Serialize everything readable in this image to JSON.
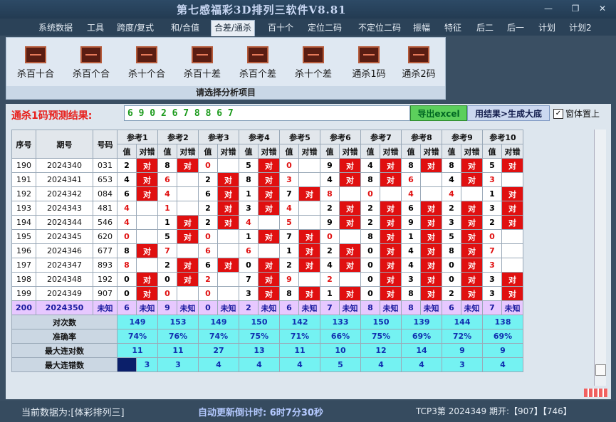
{
  "title": "第七感福彩3D排列三软件V8.81",
  "menu": [
    "系统数据",
    "工具",
    "跨度/复式",
    "和/合值",
    "合差/通杀",
    "百十个",
    "定位二码",
    "不定位二码",
    "振幅",
    "特征",
    "后二",
    "后一",
    "计划",
    "计划2"
  ],
  "active_menu": "合差/通杀",
  "ribbon": {
    "items": [
      "杀百十合",
      "杀百个合",
      "杀十个合",
      "杀百十差",
      "杀百个差",
      "杀十个差",
      "通杀1码",
      "通杀2码"
    ],
    "caption": "请选择分析项目"
  },
  "prediction": {
    "label": "通杀1码预测结果:",
    "value": "6 9 0 2 6 7 8 8 6 7",
    "excel_button": "导出excel",
    "generate_button": "用结果>生成大底",
    "topmost_label": "窗体置上",
    "topmost_checked": true
  },
  "table": {
    "headers": [
      "序号",
      "期号",
      "号码"
    ],
    "ref_headers": [
      "参考1",
      "参考2",
      "参考3",
      "参考4",
      "参考5",
      "参考6",
      "参考7",
      "参考8",
      "参考9",
      "参考10"
    ],
    "sub_headers": [
      "值",
      "对错"
    ],
    "rows": [
      {
        "seq": "190",
        "issue": "2024340",
        "num": "031",
        "vals": [
          "2",
          "8",
          "0",
          "5",
          "0",
          "9",
          "4",
          "8",
          "8",
          "5"
        ],
        "marks": [
          1,
          1,
          0,
          1,
          0,
          1,
          1,
          1,
          1,
          1
        ]
      },
      {
        "seq": "191",
        "issue": "2024341",
        "num": "653",
        "vals": [
          "4",
          "6",
          "2",
          "8",
          "3",
          "4",
          "8",
          "6",
          "4",
          "3"
        ],
        "marks": [
          1,
          0,
          1,
          1,
          0,
          1,
          1,
          0,
          1,
          0
        ]
      },
      {
        "seq": "192",
        "issue": "2024342",
        "num": "084",
        "vals": [
          "6",
          "4",
          "6",
          "1",
          "7",
          "8",
          "0",
          "4",
          "4",
          "1"
        ],
        "marks": [
          1,
          0,
          1,
          1,
          1,
          0,
          0,
          0,
          0,
          1
        ]
      },
      {
        "seq": "193",
        "issue": "2024343",
        "num": "481",
        "vals": [
          "4",
          "1",
          "2",
          "3",
          "4",
          "2",
          "2",
          "6",
          "2",
          "3"
        ],
        "marks": [
          0,
          0,
          1,
          1,
          0,
          1,
          1,
          1,
          1,
          1
        ]
      },
      {
        "seq": "194",
        "issue": "2024344",
        "num": "546",
        "vals": [
          "4",
          "1",
          "2",
          "4",
          "5",
          "9",
          "2",
          "9",
          "3",
          "2"
        ],
        "marks": [
          0,
          1,
          1,
          0,
          0,
          1,
          1,
          1,
          1,
          1
        ]
      },
      {
        "seq": "195",
        "issue": "2024345",
        "num": "620",
        "vals": [
          "0",
          "5",
          "0",
          "1",
          "7",
          "0",
          "8",
          "1",
          "5",
          "0"
        ],
        "marks": [
          0,
          1,
          0,
          1,
          1,
          0,
          1,
          1,
          1,
          0
        ]
      },
      {
        "seq": "196",
        "issue": "2024346",
        "num": "677",
        "vals": [
          "8",
          "7",
          "6",
          "6",
          "1",
          "2",
          "0",
          "4",
          "8",
          "7"
        ],
        "marks": [
          1,
          0,
          0,
          0,
          1,
          1,
          1,
          1,
          1,
          0
        ]
      },
      {
        "seq": "197",
        "issue": "2024347",
        "num": "893",
        "vals": [
          "8",
          "2",
          "6",
          "0",
          "2",
          "4",
          "0",
          "4",
          "0",
          "3"
        ],
        "marks": [
          0,
          1,
          1,
          1,
          1,
          1,
          1,
          1,
          1,
          0
        ]
      },
      {
        "seq": "198",
        "issue": "2024348",
        "num": "192",
        "vals": [
          "0",
          "0",
          "2",
          "7",
          "9",
          "2",
          "0",
          "3",
          "0",
          "3"
        ],
        "marks": [
          1,
          1,
          0,
          1,
          0,
          0,
          1,
          1,
          1,
          1
        ]
      },
      {
        "seq": "199",
        "issue": "2024349",
        "num": "907",
        "vals": [
          "0",
          "0",
          "0",
          "3",
          "8",
          "1",
          "0",
          "8",
          "2",
          "3"
        ],
        "marks": [
          1,
          0,
          0,
          1,
          1,
          1,
          1,
          1,
          1,
          1
        ]
      }
    ],
    "pending": {
      "seq": "200",
      "issue": "2024350",
      "num": "未知",
      "vals": [
        "6",
        "9",
        "0",
        "2",
        "6",
        "7",
        "8",
        "8",
        "6",
        "7"
      ],
      "status": "未知"
    },
    "mark_text": "对",
    "stats": [
      {
        "label": "对次数",
        "values": [
          "149",
          "153",
          "149",
          "150",
          "142",
          "133",
          "150",
          "139",
          "144",
          "138"
        ]
      },
      {
        "label": "准确率",
        "values": [
          "74%",
          "76%",
          "74%",
          "75%",
          "71%",
          "66%",
          "75%",
          "69%",
          "72%",
          "69%"
        ]
      },
      {
        "label": "最大连对数",
        "values": [
          "11",
          "11",
          "27",
          "13",
          "11",
          "10",
          "12",
          "14",
          "9",
          "9"
        ]
      },
      {
        "label": "最大连错数",
        "values": [
          "3",
          "3",
          "4",
          "4",
          "4",
          "5",
          "4",
          "4",
          "3",
          "4"
        ]
      }
    ]
  },
  "status": {
    "current": "当前数据为:[体彩排列三]",
    "countdown": "自动更新倒计时: 6时7分30秒",
    "latest": "TCP3第 2024349 期开:【907】【746】"
  },
  "colors": {
    "wrong_fill": "#e01010",
    "stat_fill": "#74f2f2",
    "pending_fill": "#e7c8ff",
    "prediction_text": "#1a9a1a",
    "accent_title": "#e8201c"
  }
}
